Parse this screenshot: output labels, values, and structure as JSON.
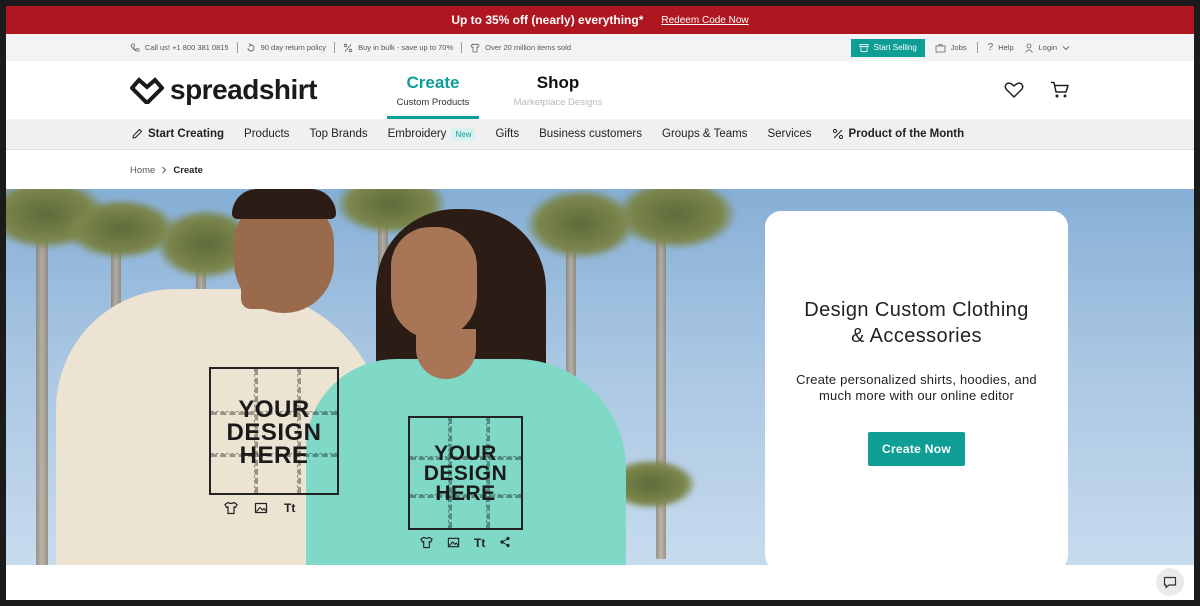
{
  "promo": {
    "text": "Up to 35% off (nearly) everything*",
    "link": "Redeem Code Now"
  },
  "utility": {
    "items": [
      {
        "icon": "phone-icon",
        "text": "Call us! +1 800 381 0815"
      },
      {
        "icon": "return-icon",
        "text": "90 day return policy"
      },
      {
        "icon": "percent-icon",
        "text": "Buy in bulk - save up to 70%"
      },
      {
        "icon": "tshirt-icon",
        "text": "Over 20 million items sold"
      }
    ],
    "start_selling": "Start Selling",
    "jobs": "Jobs",
    "help": "Help",
    "login": "Login"
  },
  "header": {
    "logo": "spreadshirt",
    "tabs": [
      {
        "title": "Create",
        "subtitle": "Custom Products"
      },
      {
        "title": "Shop",
        "subtitle": "Marketplace Designs"
      }
    ]
  },
  "catnav": {
    "items": [
      "Start Creating",
      "Products",
      "Top Brands",
      "Embroidery",
      "Gifts",
      "Business customers",
      "Groups & Teams",
      "Services",
      "Product of the Month"
    ],
    "badge": "New"
  },
  "breadcrumb": {
    "home": "Home",
    "current": "Create"
  },
  "hero": {
    "design_text": [
      "YOUR",
      "DESIGN",
      "HERE"
    ],
    "tool_icon_label": "Tt",
    "card_title_line1": "Design Custom Clothing",
    "card_title_line2": "& Accessories",
    "card_sub_line1": "Create personalized shirts, hoodies, and",
    "card_sub_line2": "much more with our online editor",
    "cta": "Create Now"
  },
  "colors": {
    "brand": "#0e9e96",
    "promo": "#b0161f"
  }
}
